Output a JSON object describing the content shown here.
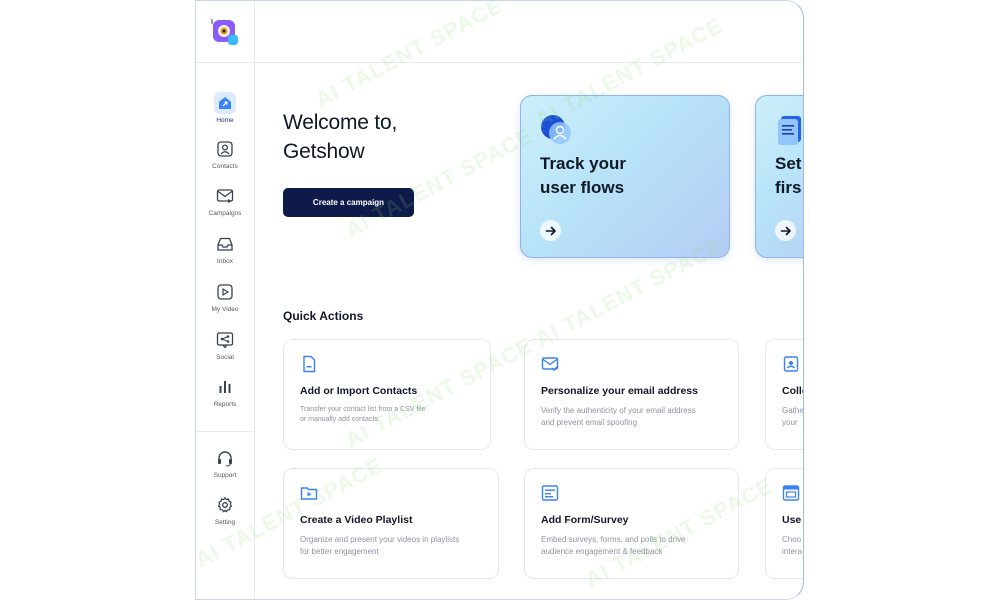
{
  "sidebar": {
    "logo_icon": "getshow-logo-icon",
    "items": [
      {
        "label": "Home",
        "icon": "home-icon"
      },
      {
        "label": "Contacts",
        "icon": "contacts-icon"
      },
      {
        "label": "Campaigns",
        "icon": "campaigns-icon"
      },
      {
        "label": "Inbox",
        "icon": "inbox-icon"
      },
      {
        "label": "My Video",
        "icon": "video-icon"
      },
      {
        "label": "Social",
        "icon": "social-icon"
      },
      {
        "label": "Reports",
        "icon": "reports-icon"
      }
    ],
    "bottom_items": [
      {
        "label": "Support",
        "icon": "headset-icon"
      },
      {
        "label": "Setting",
        "icon": "gear-icon"
      }
    ]
  },
  "welcome": {
    "line1": "Welcome to,",
    "line2": "Getshow",
    "cta_label": "Create a campaign"
  },
  "hero_cards": [
    {
      "line1": "Track your",
      "line2": "user flows"
    },
    {
      "line1": "Set",
      "line2": "firs"
    }
  ],
  "quick_actions": {
    "title": "Quick Actions",
    "items": [
      {
        "title": "Add or Import Contacts",
        "desc": "Transfer your contact list from a CSV file or manually add contacts"
      },
      {
        "title": "Personalize your email address",
        "desc": "Verify the authenticity of your email address and prevent email spoofing"
      },
      {
        "title": "Colle",
        "desc": "Gathe your"
      },
      {
        "title": "Create a Video Playlist",
        "desc": "Organize and present your videos in playlists for better engagement"
      },
      {
        "title": "Add Form/Survey",
        "desc": "Embed surveys, forms, and polls to drive audience engagement & feedback"
      },
      {
        "title": "Use",
        "desc": "Choo intera"
      }
    ]
  },
  "watermark_text": "AI TALENT SPACE",
  "colors": {
    "primary_button": "#0d1a4a",
    "accent_blue": "#3b82f6",
    "hero_gradient_start": "#cdeffb",
    "hero_gradient_end": "#b5ccf4"
  }
}
